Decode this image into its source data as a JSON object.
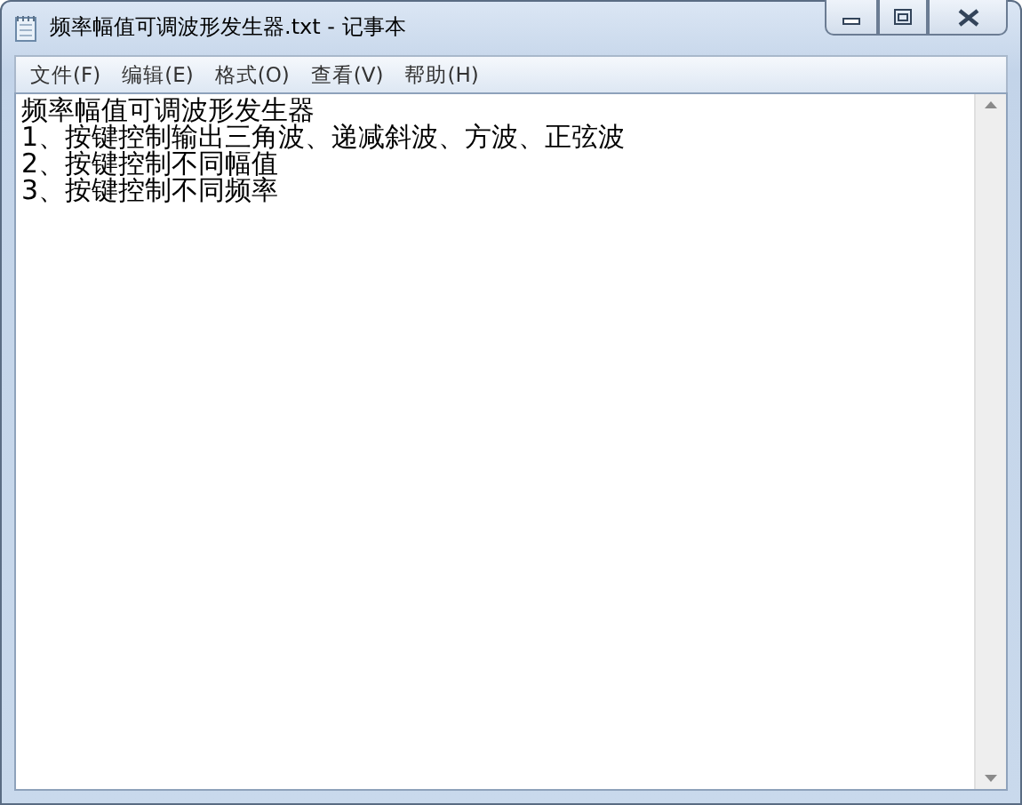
{
  "window": {
    "title": "频率幅值可调波形发生器.txt - 记事本"
  },
  "menu": [
    "文件(F)",
    "编辑(E)",
    "格式(O)",
    "查看(V)",
    "帮助(H)"
  ],
  "document": {
    "lines": [
      "频率幅值可调波形发生器",
      "1、按键控制输出三角波、递减斜波、方波、正弦波",
      "2、按键控制不同幅值",
      "3、按键控制不同频率"
    ]
  }
}
